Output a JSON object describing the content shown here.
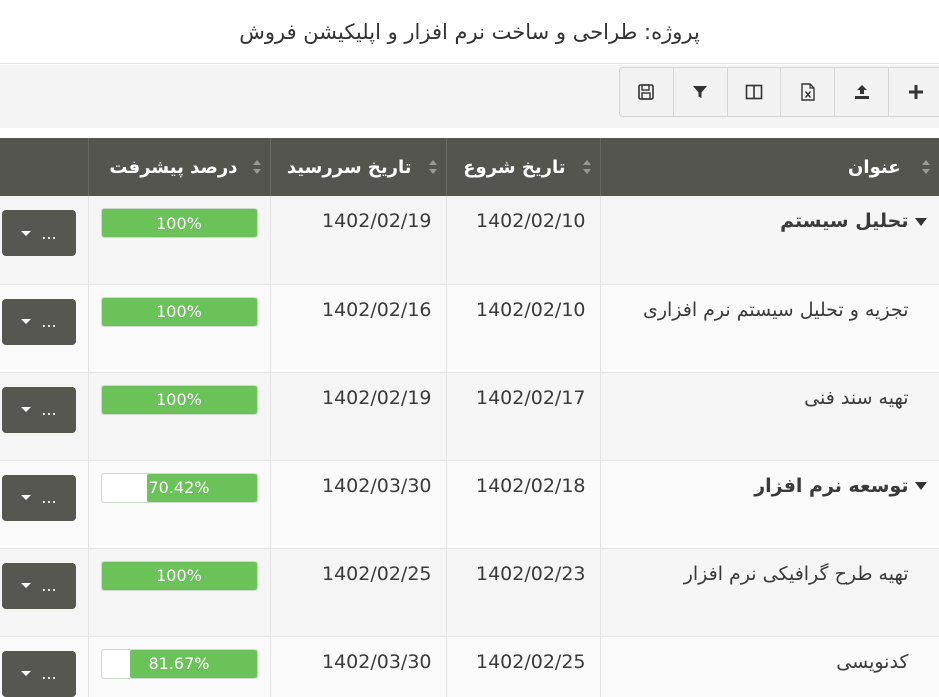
{
  "header": {
    "title": "پروژه: طراحی و ساخت نرم افزار و اپلیکیشن فروش"
  },
  "toolbar": {
    "buttons": [
      {
        "icon": "save-icon"
      },
      {
        "icon": "filter-icon"
      },
      {
        "icon": "columns-icon"
      },
      {
        "icon": "excel-icon"
      },
      {
        "icon": "upload-icon"
      },
      {
        "icon": "plus-icon"
      }
    ]
  },
  "grid": {
    "columns": {
      "title": "عنوان",
      "start": "تاریخ شروع",
      "due": "تاریخ سررسید",
      "progress": "درصد پیشرفت"
    },
    "rows": [
      {
        "title": "تحلیل سیستم",
        "group": true,
        "start": "1402/02/10",
        "due": "1402/02/19",
        "progress": 100,
        "progress_label": "100%",
        "action": "..."
      },
      {
        "title": "تجزیه و تحلیل سیستم نرم افزاری",
        "group": false,
        "start": "1402/02/10",
        "due": "1402/02/16",
        "progress": 100,
        "progress_label": "100%",
        "action": "..."
      },
      {
        "title": "تهیه سند فنی",
        "group": false,
        "start": "1402/02/17",
        "due": "1402/02/19",
        "progress": 100,
        "progress_label": "100%",
        "action": "..."
      },
      {
        "title": "توسعه نرم افزار",
        "group": true,
        "start": "1402/02/18",
        "due": "1402/03/30",
        "progress": 70.42,
        "progress_label": "70.42%",
        "action": "..."
      },
      {
        "title": "تهیه طرح گرافیکی نرم افزار",
        "group": false,
        "start": "1402/02/23",
        "due": "1402/02/25",
        "progress": 100,
        "progress_label": "100%",
        "action": "..."
      },
      {
        "title": "کدنویسی",
        "group": false,
        "start": "1402/02/25",
        "due": "1402/03/30",
        "progress": 81.67,
        "progress_label": "81.67%",
        "action": "..."
      }
    ]
  },
  "colors": {
    "header_bg": "#555550",
    "progress_fill": "#6ac259",
    "action_bg": "#575752"
  }
}
